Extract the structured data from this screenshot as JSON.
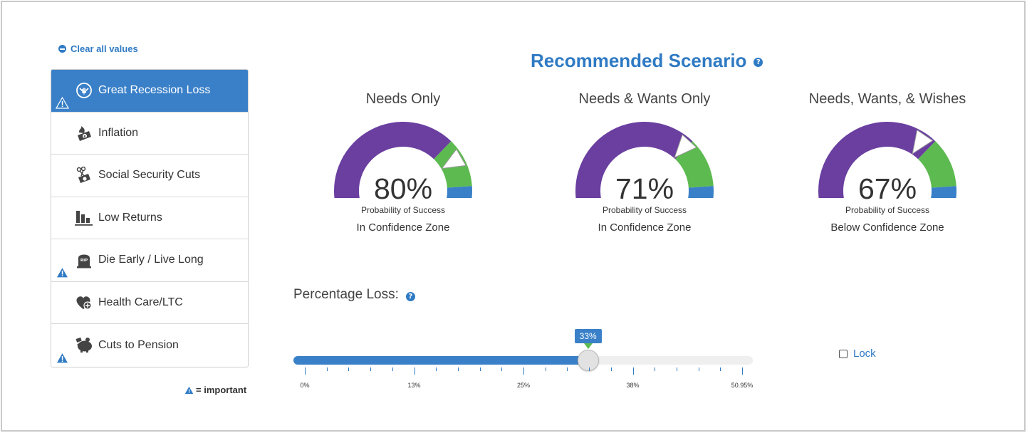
{
  "clear_label": "Clear all values",
  "sidebar": {
    "items": [
      {
        "label": "Great Recession Loss",
        "icon": "dollar-down-icon",
        "active": true,
        "important": true
      },
      {
        "label": "Inflation",
        "icon": "burning-money-icon",
        "active": false,
        "important": false
      },
      {
        "label": "Social Security Cuts",
        "icon": "scissors-money-icon",
        "active": false,
        "important": false
      },
      {
        "label": "Low Returns",
        "icon": "bar-chart-icon",
        "active": false,
        "important": false
      },
      {
        "label": "Die Early / Live Long",
        "icon": "tombstone-icon",
        "active": false,
        "important": true,
        "icon_text": "RIP"
      },
      {
        "label": "Health Care/LTC",
        "icon": "heart-plus-icon",
        "active": false,
        "important": false
      },
      {
        "label": "Cuts to Pension",
        "icon": "piggy-bank-icon",
        "active": false,
        "important": true
      }
    ]
  },
  "legend_label": "= important",
  "recommended_title": "Recommended Scenario",
  "gauges": [
    {
      "title": "Needs Only",
      "percent": "80%",
      "prob_label": "Probability of Success",
      "zone": "In Confidence Zone",
      "value": 80
    },
    {
      "title": "Needs & Wants Only",
      "percent": "71%",
      "prob_label": "Probability of Success",
      "zone": "In Confidence Zone",
      "value": 71
    },
    {
      "title": "Needs, Wants, & Wishes",
      "percent": "67%",
      "prob_label": "Probability of Success",
      "zone": "Below Confidence Zone",
      "value": 67
    }
  ],
  "colors": {
    "purple": "#6a3fa0",
    "green": "#5dba50",
    "blue": "#3a80c8",
    "accent": "#2f7ac4"
  },
  "slider": {
    "title": "Percentage Loss:",
    "value_label": "33%",
    "value": 33,
    "min": 0,
    "max": 50.95,
    "tick_labels": [
      "0%",
      "13%",
      "25%",
      "38%",
      "50.95%"
    ]
  },
  "lock_label": "Lock"
}
